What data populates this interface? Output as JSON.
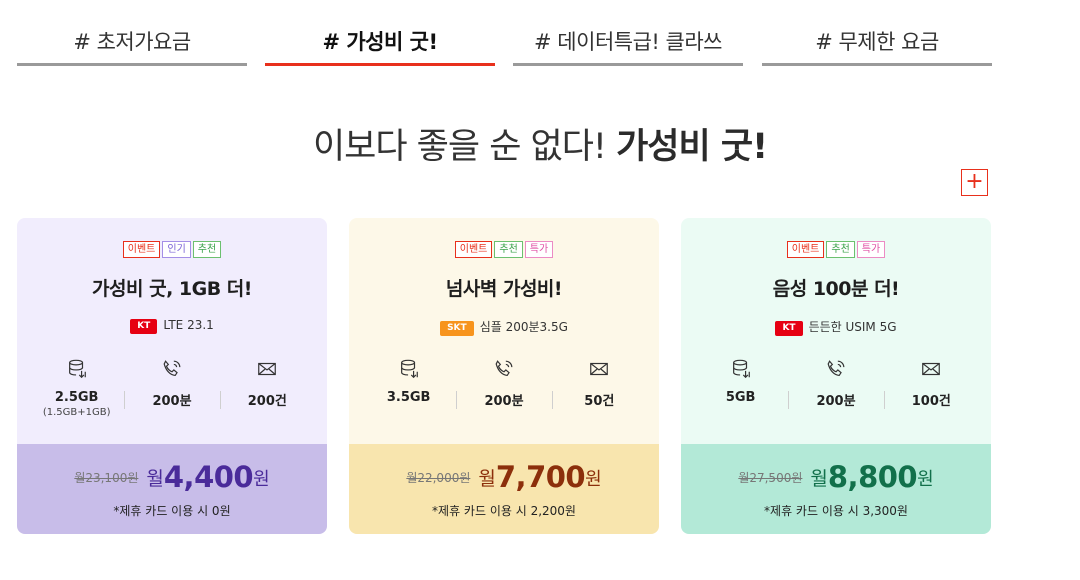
{
  "tabs": [
    {
      "label": "# 초저가요금",
      "active": false
    },
    {
      "label": "# 가성비 굿!",
      "active": true
    },
    {
      "label": "# 데이터특급! 클라쓰",
      "active": false
    },
    {
      "label": "# 무제한 요금",
      "active": false
    }
  ],
  "headline": {
    "text": "이보다 좋을 순 없다!",
    "strong": "가성비 굿!"
  },
  "more_button": {
    "label": "+"
  },
  "colors": {
    "accent": "#e8301c"
  },
  "cards": [
    {
      "badges": [
        "이벤트",
        "인기",
        "추천"
      ],
      "title": "가성비 굿, 1GB 더!",
      "carrier": {
        "logo": "KT",
        "plan": "LTE 23.1"
      },
      "specs": [
        {
          "icon": "data-icon",
          "value": "2.5GB",
          "sub": "(1.5GB+1GB)"
        },
        {
          "icon": "call-icon",
          "value": "200분",
          "sub": ""
        },
        {
          "icon": "mail-icon",
          "value": "200건",
          "sub": ""
        }
      ],
      "price": {
        "original": "월23,100원",
        "month": "월",
        "amount": "4,400",
        "won": "원"
      },
      "discount": "*제휴 카드 이용 시 0원",
      "colors": {
        "top": "#f1edfd",
        "bottom": "#c8bde9",
        "price": "#4a2b9a"
      }
    },
    {
      "badges": [
        "이벤트",
        "추천",
        "특가"
      ],
      "title": "넘사벽 가성비!",
      "carrier": {
        "logo": "SKT",
        "plan": "심플 200분3.5G"
      },
      "specs": [
        {
          "icon": "data-icon",
          "value": "3.5GB",
          "sub": ""
        },
        {
          "icon": "call-icon",
          "value": "200분",
          "sub": ""
        },
        {
          "icon": "mail-icon",
          "value": "50건",
          "sub": ""
        }
      ],
      "price": {
        "original": "월22,000원",
        "month": "월",
        "amount": "7,700",
        "won": "원"
      },
      "discount": "*제휴 카드 이용 시 2,200원",
      "colors": {
        "top": "#fdf8e8",
        "bottom": "#f8e5ae",
        "price": "#8c2f0b"
      }
    },
    {
      "badges": [
        "이벤트",
        "추천",
        "특가"
      ],
      "title": "음성 100분 더!",
      "carrier": {
        "logo": "KT",
        "plan": "든든한 USIM 5G"
      },
      "specs": [
        {
          "icon": "data-icon",
          "value": "5GB",
          "sub": ""
        },
        {
          "icon": "call-icon",
          "value": "200분",
          "sub": ""
        },
        {
          "icon": "mail-icon",
          "value": "100건",
          "sub": ""
        }
      ],
      "price": {
        "original": "월27,500원",
        "month": "월",
        "amount": "8,800",
        "won": "원"
      },
      "discount": "*제휴 카드 이용 시 3,300원",
      "colors": {
        "top": "#ebfbf4",
        "bottom": "#b3e9d7",
        "price": "#12704b"
      }
    }
  ]
}
